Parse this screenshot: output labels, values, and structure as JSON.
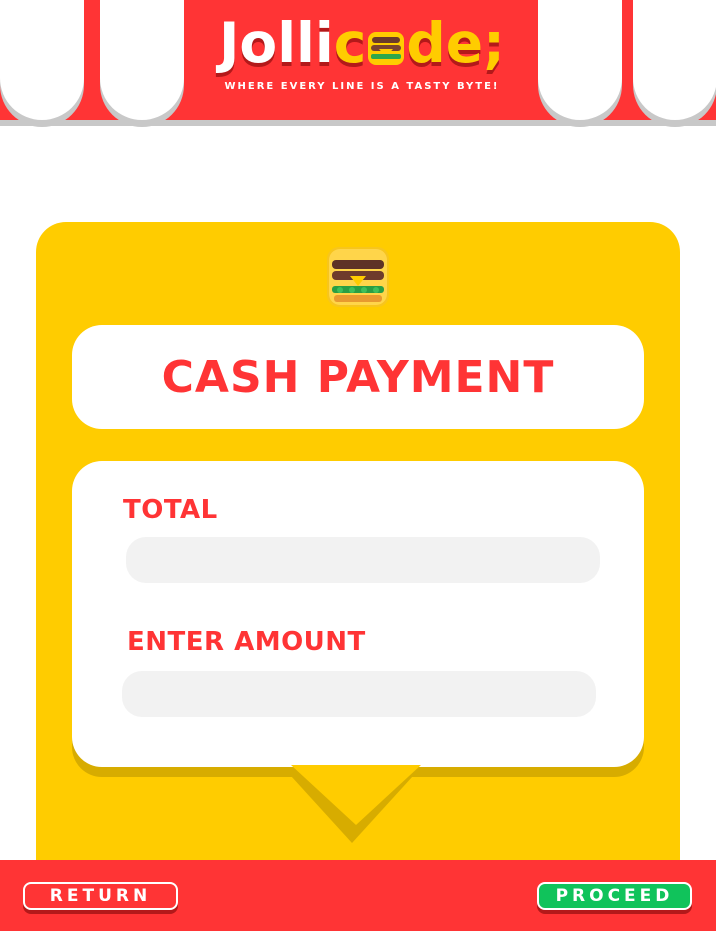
{
  "header": {
    "logo_part1": "Jolli",
    "logo_part2": "c",
    "logo_part3": "de;",
    "tagline": "WHERE EVERY LINE IS A TASTY BYTE!"
  },
  "card": {
    "icon": "burger-icon",
    "title": "CASH PAYMENT"
  },
  "form": {
    "total_label": "TOTAL",
    "total_value": "",
    "amount_label": "ENTER AMOUNT",
    "amount_value": ""
  },
  "footer": {
    "return_label": "RETURN",
    "proceed_label": "PROCEED"
  },
  "colors": {
    "brand_red": "#ff3435",
    "brand_yellow": "#ffcc00",
    "proceed_green": "#10c35b"
  }
}
